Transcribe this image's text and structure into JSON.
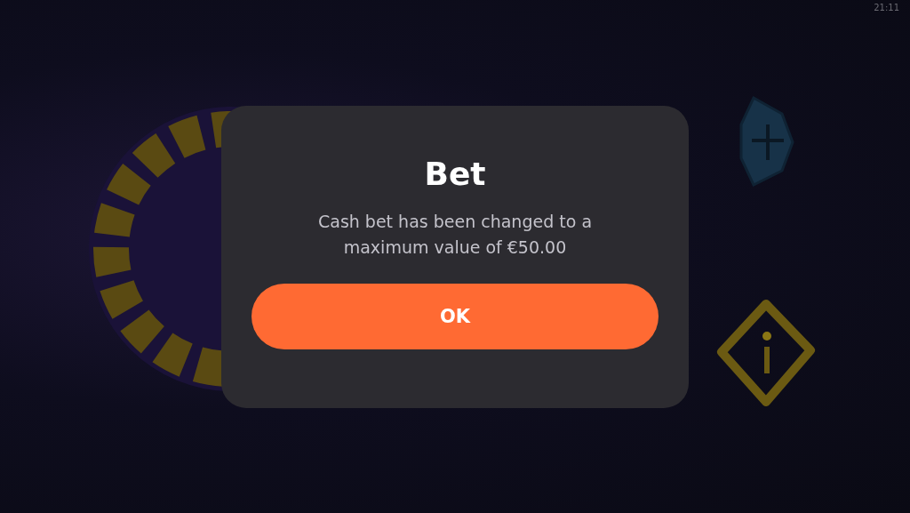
{
  "status_bar": {
    "time": "21:11"
  },
  "dialog": {
    "title": "Bet",
    "message": "Cash bet has been changed to a maximum value of €50.00",
    "buttons": [
      "OK"
    ]
  }
}
